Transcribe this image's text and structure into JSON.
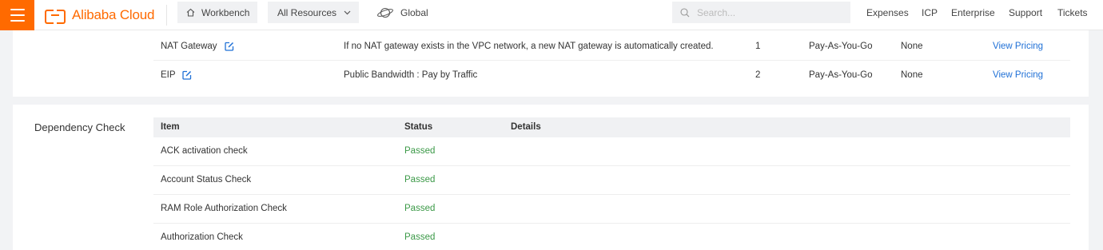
{
  "topbar": {
    "brand": "Alibaba Cloud",
    "workbench": "Workbench",
    "resources": "All Resources",
    "region": "Global",
    "search_placeholder": "Search...",
    "links": [
      "Expenses",
      "ICP",
      "Enterprise",
      "Support",
      "Tickets"
    ],
    "accent_color": "#ff6a00"
  },
  "resources": {
    "rows": [
      {
        "item": "NAT Gateway",
        "description": "If no NAT gateway exists in the VPC network, a new NAT gateway is automatically created.",
        "quantity": "1",
        "billing": "Pay-As-You-Go",
        "extra": "None",
        "action": "View Pricing"
      },
      {
        "item": "EIP",
        "description": "Public Bandwidth : Pay by Traffic",
        "quantity": "2",
        "billing": "Pay-As-You-Go",
        "extra": "None",
        "action": "View Pricing"
      }
    ]
  },
  "dependency": {
    "title": "Dependency Check",
    "columns": [
      "Item",
      "Status",
      "Details"
    ],
    "rows": [
      {
        "item": "ACK activation check",
        "status": "Passed"
      },
      {
        "item": "Account Status Check",
        "status": "Passed"
      },
      {
        "item": "RAM Role Authorization Check",
        "status": "Passed"
      },
      {
        "item": "Authorization Check",
        "status": "Passed"
      }
    ],
    "passed_color": "#3b9947"
  }
}
